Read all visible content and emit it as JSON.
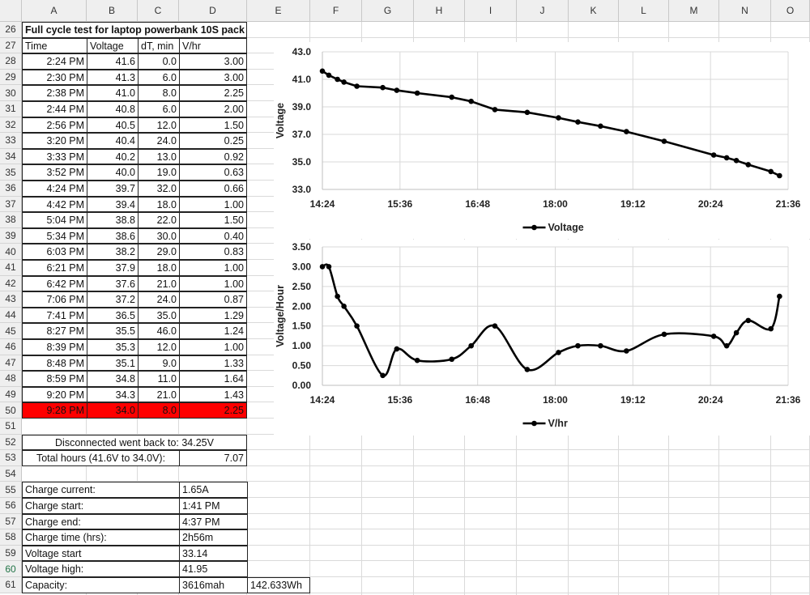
{
  "columns": [
    "A",
    "B",
    "C",
    "D",
    "E",
    "F",
    "G",
    "H",
    "I",
    "J",
    "K",
    "L",
    "M",
    "N",
    "O"
  ],
  "rows": [
    "26",
    "27",
    "28",
    "29",
    "30",
    "31",
    "32",
    "33",
    "34",
    "35",
    "36",
    "37",
    "38",
    "39",
    "40",
    "41",
    "42",
    "43",
    "44",
    "45",
    "46",
    "47",
    "48",
    "49",
    "50",
    "51",
    "52",
    "53",
    "54",
    "55",
    "56",
    "57",
    "58",
    "59",
    "60",
    "61"
  ],
  "title": "Full cycle test for laptop powerbank 10S pack",
  "headers": {
    "time": "Time",
    "voltage": "Voltage",
    "dt": "dT, min",
    "vhr": "V/hr"
  },
  "data_rows": [
    [
      "2:24 PM",
      "41.6",
      "0.0",
      "3.00"
    ],
    [
      "2:30 PM",
      "41.3",
      "6.0",
      "3.00"
    ],
    [
      "2:38 PM",
      "41.0",
      "8.0",
      "2.25"
    ],
    [
      "2:44 PM",
      "40.8",
      "6.0",
      "2.00"
    ],
    [
      "2:56 PM",
      "40.5",
      "12.0",
      "1.50"
    ],
    [
      "3:20 PM",
      "40.4",
      "24.0",
      "0.25"
    ],
    [
      "3:33 PM",
      "40.2",
      "13.0",
      "0.92"
    ],
    [
      "3:52 PM",
      "40.0",
      "19.0",
      "0.63"
    ],
    [
      "4:24 PM",
      "39.7",
      "32.0",
      "0.66"
    ],
    [
      "4:42 PM",
      "39.4",
      "18.0",
      "1.00"
    ],
    [
      "5:04 PM",
      "38.8",
      "22.0",
      "1.50"
    ],
    [
      "5:34 PM",
      "38.6",
      "30.0",
      "0.40"
    ],
    [
      "6:03 PM",
      "38.2",
      "29.0",
      "0.83"
    ],
    [
      "6:21 PM",
      "37.9",
      "18.0",
      "1.00"
    ],
    [
      "6:42 PM",
      "37.6",
      "21.0",
      "1.00"
    ],
    [
      "7:06 PM",
      "37.2",
      "24.0",
      "0.87"
    ],
    [
      "7:41 PM",
      "36.5",
      "35.0",
      "1.29"
    ],
    [
      "8:27 PM",
      "35.5",
      "46.0",
      "1.24"
    ],
    [
      "8:39 PM",
      "35.3",
      "12.0",
      "1.00"
    ],
    [
      "8:48 PM",
      "35.1",
      "9.0",
      "1.33"
    ],
    [
      "8:59 PM",
      "34.8",
      "11.0",
      "1.64"
    ],
    [
      "9:20 PM",
      "34.3",
      "21.0",
      "1.43"
    ],
    [
      "9:28 PM",
      "34.0",
      "8.0",
      "2.25"
    ]
  ],
  "disconnected": "Disconnected went back to: 34.25V",
  "total_hours_label": "Total hours (41.6V to 34.0V):",
  "total_hours_value": "7.07",
  "info": [
    {
      "label": "Charge current:",
      "value": "1.65A"
    },
    {
      "label": "Charge start:",
      "value": "1:41 PM"
    },
    {
      "label": "Charge end:",
      "value": "4:37 PM"
    },
    {
      "label": "Charge time (hrs):",
      "value": "2h56m"
    },
    {
      "label": "Voltage start",
      "value": "33.14"
    },
    {
      "label": "Voltage high:",
      "value": "41.95"
    },
    {
      "label": "Capacity:",
      "value": "3616mah",
      "extra": "142.633Wh"
    }
  ],
  "colors": {
    "highlight_row": "#ff0000",
    "selected_row_header": "#217346",
    "series_line": "#000000"
  },
  "chart_data": [
    {
      "type": "line",
      "title": "",
      "xlabel": "",
      "ylabel": "Voltage",
      "legend": "bottom",
      "grid": true,
      "x_ticks": [
        "14:24",
        "15:36",
        "16:48",
        "18:00",
        "19:12",
        "20:24",
        "21:36"
      ],
      "x_range": [
        "14:24",
        "21:36"
      ],
      "ylim": [
        33.0,
        43.0
      ],
      "y_ticks": [
        "33.0",
        "35.0",
        "37.0",
        "39.0",
        "41.0",
        "43.0"
      ],
      "x": [
        "14:24",
        "14:30",
        "14:38",
        "14:44",
        "14:56",
        "15:20",
        "15:33",
        "15:52",
        "16:24",
        "16:42",
        "17:04",
        "17:34",
        "18:03",
        "18:21",
        "18:42",
        "19:06",
        "19:41",
        "20:27",
        "20:39",
        "20:48",
        "20:59",
        "21:20",
        "21:28"
      ],
      "series": [
        {
          "name": "Voltage",
          "values": [
            41.6,
            41.3,
            41.0,
            40.8,
            40.5,
            40.4,
            40.2,
            40.0,
            39.7,
            39.4,
            38.8,
            38.6,
            38.2,
            37.9,
            37.6,
            37.2,
            36.5,
            35.5,
            35.3,
            35.1,
            34.8,
            34.3,
            34.0
          ]
        }
      ]
    },
    {
      "type": "line",
      "title": "",
      "xlabel": "",
      "ylabel": "Voltage/Hour",
      "legend": "bottom",
      "grid": true,
      "smooth": true,
      "x_ticks": [
        "14:24",
        "15:36",
        "16:48",
        "18:00",
        "19:12",
        "20:24",
        "21:36"
      ],
      "x_range": [
        "14:24",
        "21:36"
      ],
      "ylim": [
        0.0,
        3.5
      ],
      "y_ticks": [
        "0.00",
        "0.50",
        "1.00",
        "1.50",
        "2.00",
        "2.50",
        "3.00",
        "3.50"
      ],
      "x": [
        "14:24",
        "14:30",
        "14:38",
        "14:44",
        "14:56",
        "15:20",
        "15:33",
        "15:52",
        "16:24",
        "16:42",
        "17:04",
        "17:34",
        "18:03",
        "18:21",
        "18:42",
        "19:06",
        "19:41",
        "20:27",
        "20:39",
        "20:48",
        "20:59",
        "21:20",
        "21:28"
      ],
      "series": [
        {
          "name": "V/hr",
          "values": [
            3.0,
            3.0,
            2.25,
            2.0,
            1.5,
            0.25,
            0.92,
            0.63,
            0.66,
            1.0,
            1.5,
            0.4,
            0.83,
            1.0,
            1.0,
            0.87,
            1.29,
            1.24,
            1.0,
            1.33,
            1.64,
            1.43,
            2.25
          ]
        }
      ]
    }
  ]
}
